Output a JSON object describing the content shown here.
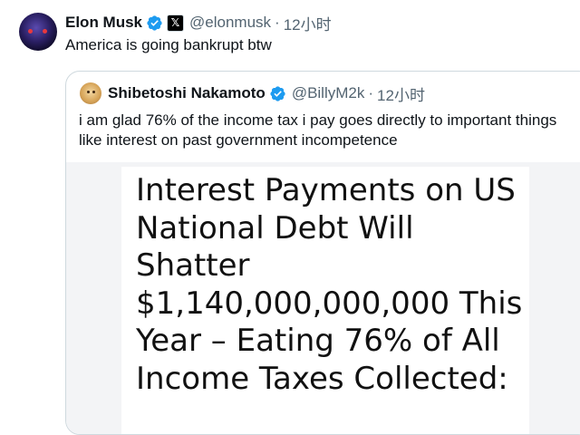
{
  "tweet": {
    "author_name": "Elon Musk",
    "x_badge": "𝕏",
    "handle": "@elonmusk",
    "separator": "·",
    "time": "12小时",
    "text": "America is going bankrupt btw"
  },
  "quote": {
    "author_name": "Shibetoshi Nakamoto",
    "handle": "@BillyM2k",
    "separator": "·",
    "time": "12小时",
    "text": "i am glad 76% of the income tax i pay goes directly to important things like interest on past government incompetence",
    "media": {
      "headline": "Interest Payments on US\nNational Debt Will\nShatter\n$1,140,000,000,000 This\nYear – Eating 76% of All\nIncome Taxes Collected:"
    }
  },
  "icons": {
    "verified": "verified-badge-icon",
    "x": "x-logo-icon"
  },
  "colors": {
    "verified_blue": "#1d9bf0",
    "secondary_text": "#536471",
    "border": "#cfd9de"
  }
}
